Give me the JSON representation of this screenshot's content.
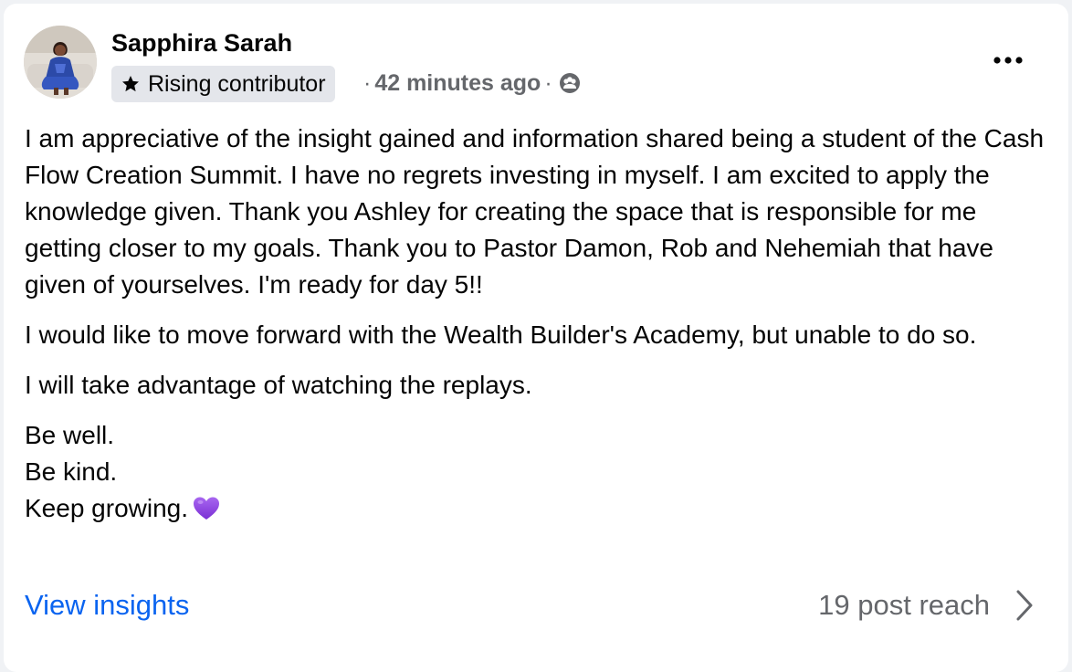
{
  "post": {
    "author": {
      "name": "Sapphira Sarah",
      "badge": "Rising contributor"
    },
    "meta": {
      "separator": "·",
      "timestamp": "42 minutes ago",
      "audience_icon": "group-audience-icon"
    },
    "paragraphs": [
      "I am appreciative of the insight gained and information shared being a student of the Cash Flow Creation Summit. I have no regrets investing in myself. I am excited to apply the knowledge given. Thank you Ashley for creating the space that is responsible for me getting closer to my goals. Thank you to Pastor Damon, Rob and Nehemiah that have given of yourselves. I'm ready for day 5!!",
      "I would like to move forward with the Wealth Builder's Academy, but unable to do so.",
      "I will take advantage of watching the replays."
    ],
    "signoff": [
      "Be well.",
      "Be kind.",
      "Keep growing."
    ],
    "emoji": "purple-heart"
  },
  "footer": {
    "view_insights": "View insights",
    "reach": "19 post reach"
  },
  "colors": {
    "link": "#0a64f0",
    "secondary_text": "#65676b",
    "badge_bg": "#e4e6eb",
    "heart": "#8b3fe0"
  }
}
